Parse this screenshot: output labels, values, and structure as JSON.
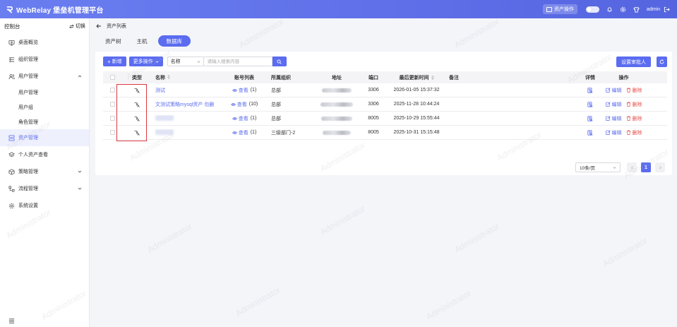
{
  "app": {
    "title": "WebRelay 堡垒机管理平台"
  },
  "header": {
    "asset_op_label": "资产操作",
    "user": "admin"
  },
  "sidebar": {
    "title": "控制台",
    "switch_label": "切换",
    "items": [
      {
        "label": "桌面概览",
        "icon": "monitor-icon"
      },
      {
        "label": "组织管理",
        "icon": "org-icon"
      },
      {
        "label": "用户管理",
        "icon": "users-icon",
        "expanded": true,
        "children": [
          "用户管理",
          "用户组",
          "角色管理"
        ]
      },
      {
        "label": "资产管理",
        "icon": "asset-icon",
        "active": true
      },
      {
        "label": "个人资产查看",
        "icon": "layers-icon"
      },
      {
        "label": "策略管理",
        "icon": "policy-icon"
      },
      {
        "label": "流程管理",
        "icon": "flow-icon"
      },
      {
        "label": "系统设置",
        "icon": "gear-icon"
      }
    ]
  },
  "breadcrumb": "资产列表",
  "tabs": [
    {
      "label": "资产树",
      "active": false
    },
    {
      "label": "主机",
      "active": false
    },
    {
      "label": "数据库",
      "active": true
    }
  ],
  "toolbar": {
    "new_label": "新增",
    "more_label": "更多操作",
    "search_field": "名称",
    "search_placeholder": "请输入搜索内容",
    "approver_label": "设置审批人"
  },
  "table": {
    "columns": {
      "type": "类型",
      "name": "名称",
      "accounts": "账号列表",
      "org": "所属组织",
      "address": "地址",
      "port": "端口",
      "updated": "最后更新时间",
      "remark": "备注",
      "detail": "详情",
      "ops": "操作"
    },
    "view_label": "查看",
    "edit_label": "编辑",
    "delete_label": "删除",
    "rows": [
      {
        "name": "测试",
        "name_blurred": false,
        "accounts": "(1)",
        "org": "总部",
        "port": "3306",
        "updated": "2026-01-05 15:37:32",
        "remark": ""
      },
      {
        "name": "文测试策略mysql资产 勿删",
        "name_blurred": false,
        "accounts": "(10)",
        "org": "总部",
        "port": "3306",
        "updated": "2025-11-28 10:44:24",
        "remark": ""
      },
      {
        "name": "",
        "name_blurred": true,
        "accounts": "(1)",
        "org": "总部",
        "port": "8005",
        "updated": "2025-10-29 15:55:44",
        "remark": ""
      },
      {
        "name": "",
        "name_blurred": true,
        "accounts": "(1)",
        "org": "三级部门-2",
        "port": "8005",
        "updated": "2025-10-31 15:15:48",
        "remark": ""
      }
    ]
  },
  "pagination": {
    "page_size": "10条/页",
    "current": "1"
  },
  "watermark": "Administrator",
  "colors": {
    "primary": "#5b6cf0",
    "danger": "#e2514b",
    "header": "#6172ea"
  }
}
